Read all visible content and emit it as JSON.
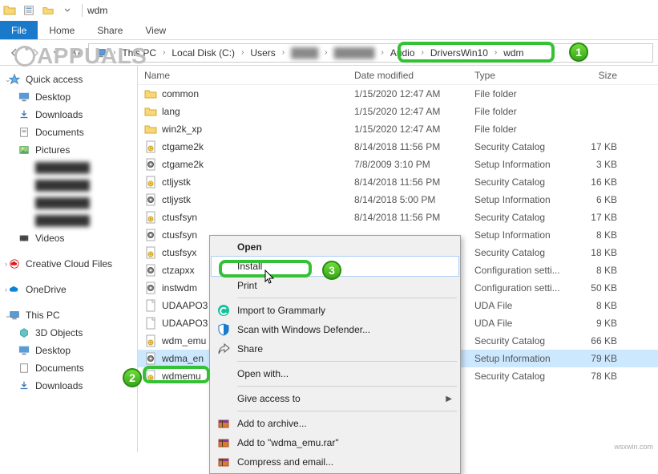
{
  "titlebar": {
    "title": "wdm"
  },
  "ribbon": {
    "file": "File",
    "home": "Home",
    "share": "Share",
    "view": "View"
  },
  "breadcrumb": {
    "thispc": "This PC",
    "localdisk": "Local Disk (C:)",
    "users": "Users",
    "audio": "Audio",
    "driverswin10": "DriversWin10",
    "wdm": "wdm"
  },
  "sidebar": {
    "quickaccess": "Quick access",
    "desktop": "Desktop",
    "downloads": "Downloads",
    "documents": "Documents",
    "pictures": "Pictures",
    "videos": "Videos",
    "creativecloud": "Creative Cloud Files",
    "onedrive": "OneDrive",
    "thispc": "This PC",
    "objects3d": "3D Objects",
    "desktop2": "Desktop",
    "documents2": "Documents",
    "downloads2": "Downloads"
  },
  "columns": {
    "name": "Name",
    "modified": "Date modified",
    "type": "Type",
    "size": "Size"
  },
  "files": [
    {
      "name": "common",
      "date": "1/15/2020 12:47 AM",
      "type": "File folder",
      "size": "",
      "icon": "folder"
    },
    {
      "name": "lang",
      "date": "1/15/2020 12:47 AM",
      "type": "File folder",
      "size": "",
      "icon": "folder"
    },
    {
      "name": "win2k_xp",
      "date": "1/15/2020 12:47 AM",
      "type": "File folder",
      "size": "",
      "icon": "folder"
    },
    {
      "name": "ctgame2k",
      "date": "8/14/2018 11:56 PM",
      "type": "Security Catalog",
      "size": "17 KB",
      "icon": "catalog"
    },
    {
      "name": "ctgame2k",
      "date": "7/8/2009 3:10 PM",
      "type": "Setup Information",
      "size": "3 KB",
      "icon": "inf"
    },
    {
      "name": "ctljystk",
      "date": "8/14/2018 11:56 PM",
      "type": "Security Catalog",
      "size": "16 KB",
      "icon": "catalog"
    },
    {
      "name": "ctljystk",
      "date": "8/14/2018 5:00 PM",
      "type": "Setup Information",
      "size": "6 KB",
      "icon": "inf"
    },
    {
      "name": "ctusfsyn",
      "date": "8/14/2018 11:56 PM",
      "type": "Security Catalog",
      "size": "17 KB",
      "icon": "catalog"
    },
    {
      "name": "ctusfsyn",
      "date": "",
      "type": "Setup Information",
      "size": "8 KB",
      "icon": "inf"
    },
    {
      "name": "ctusfsyx",
      "date": "",
      "type": "Security Catalog",
      "size": "18 KB",
      "icon": "catalog"
    },
    {
      "name": "ctzapxx",
      "date": "",
      "type": "Configuration setti...",
      "size": "8 KB",
      "icon": "inf"
    },
    {
      "name": "instwdm",
      "date": "",
      "type": "Configuration setti...",
      "size": "50 KB",
      "icon": "inf"
    },
    {
      "name": "UDAAPO3",
      "date": "",
      "type": "UDA File",
      "size": "8 KB",
      "icon": "generic"
    },
    {
      "name": "UDAAPO3",
      "date": "",
      "type": "UDA File",
      "size": "9 KB",
      "icon": "generic"
    },
    {
      "name": "wdm_emu",
      "date": "",
      "type": "Security Catalog",
      "size": "66 KB",
      "icon": "catalog"
    },
    {
      "name": "wdma_en",
      "date": "",
      "type": "Setup Information",
      "size": "79 KB",
      "icon": "inf",
      "selected": true
    },
    {
      "name": "wdmemu",
      "date": "",
      "type": "Security Catalog",
      "size": "78 KB",
      "icon": "catalog"
    }
  ],
  "contextmenu": {
    "open": "Open",
    "install": "Install",
    "print": "Print",
    "grammarly": "Import to Grammarly",
    "defender": "Scan with Windows Defender...",
    "share": "Share",
    "openwith": "Open with...",
    "giveaccess": "Give access to",
    "addarchive": "Add to archive...",
    "addrar": "Add to \"wdma_emu.rar\"",
    "compressemail": "Compress and email..."
  },
  "watermark": "APPUALS",
  "wsxwin": "wsxwin.com"
}
